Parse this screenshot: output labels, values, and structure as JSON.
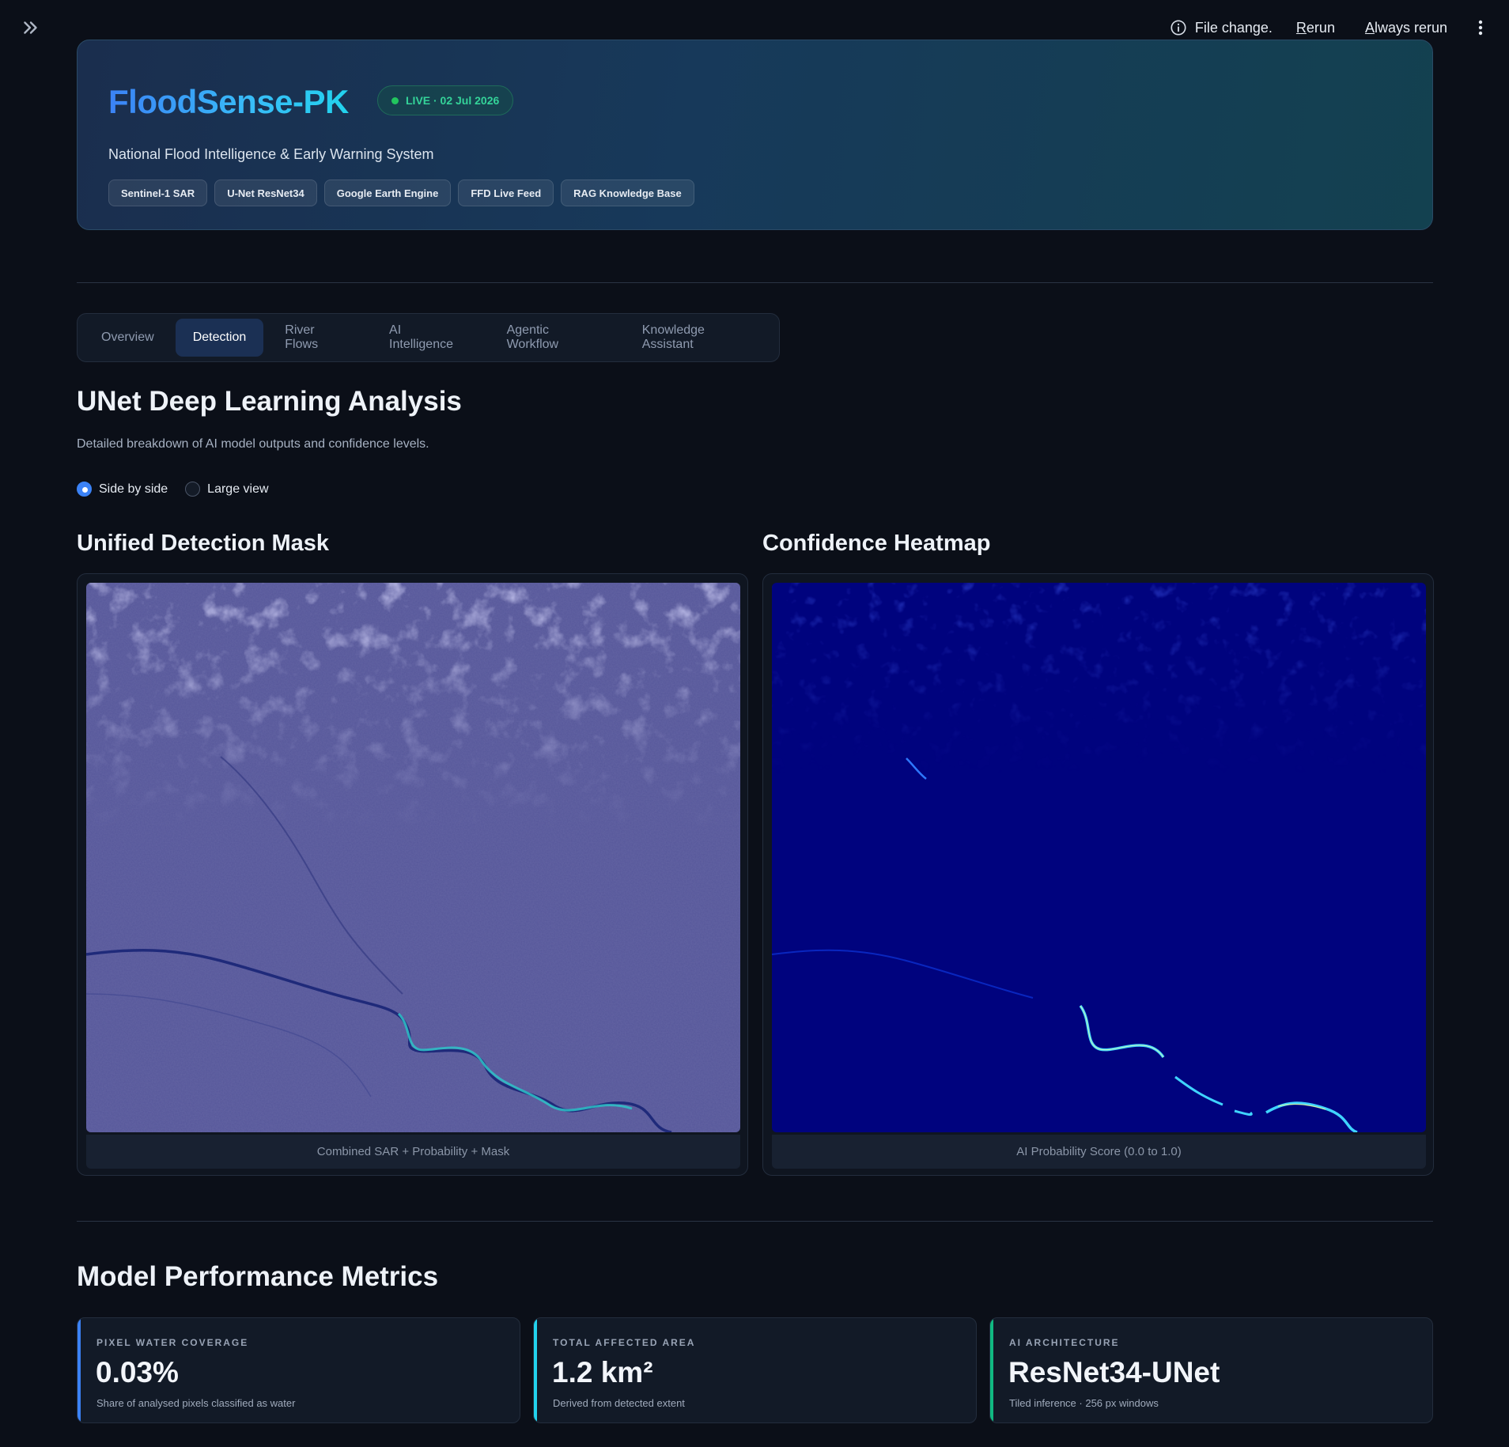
{
  "toolbar": {
    "file_change": "File change.",
    "rerun_u": "R",
    "rerun_rest": "erun",
    "always_u": "A",
    "always_rest": "lways rerun"
  },
  "hero": {
    "title": "FloodSense-PK",
    "live_badge": "LIVE · 02 Jul 2026",
    "subtitle": "National Flood Intelligence & Early Warning System",
    "tags": [
      "Sentinel-1 SAR",
      "U-Net ResNet34",
      "Google Earth Engine",
      "FFD Live Feed",
      "RAG Knowledge Base"
    ]
  },
  "tabs": [
    "Overview",
    "Detection",
    "River Flows",
    "AI Intelligence",
    "Agentic Workflow",
    "Knowledge Assistant"
  ],
  "active_tab": "Detection",
  "section": {
    "title": "UNet Deep Learning Analysis",
    "description": "Detailed breakdown of AI model outputs and confidence levels."
  },
  "view_mode": {
    "options": [
      "Side by side",
      "Large view"
    ],
    "selected": "Side by side"
  },
  "panels": {
    "mask": {
      "title": "Unified Detection Mask",
      "caption": "Combined SAR + Probability + Mask"
    },
    "heatmap": {
      "title": "Confidence Heatmap",
      "caption": "AI Probability Score (0.0 to 1.0)"
    }
  },
  "metrics": {
    "title": "Model Performance Metrics",
    "cards": [
      {
        "label": "PIXEL WATER COVERAGE",
        "value": "0.03%",
        "note": "Share of analysed pixels classified as water",
        "accent": "#3b82f6"
      },
      {
        "label": "TOTAL AFFECTED AREA",
        "value": "1.2 km²",
        "note": "Derived from detected extent",
        "accent": "#22d3ee"
      },
      {
        "label": "AI ARCHITECTURE",
        "value": "ResNet34-UNet",
        "note": "Tiled inference · 256 px windows",
        "accent": "#10b981"
      }
    ]
  },
  "colors": {
    "background": "#0b0f18",
    "accent": "#3b82f6",
    "live": "#22c55e"
  }
}
